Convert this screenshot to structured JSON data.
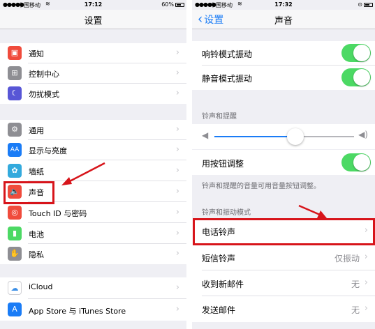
{
  "left": {
    "status": {
      "carrier": "中国移动",
      "time": "17:12",
      "battery": "60%"
    },
    "title": "设置",
    "rows": [
      {
        "label": "通知",
        "icon_color": "#f04b3c"
      },
      {
        "label": "控制中心",
        "icon_color": "#8e8e93"
      },
      {
        "label": "勿扰模式",
        "icon_color": "#5856d6"
      },
      {
        "label": "通用",
        "icon_color": "#8e8e93"
      },
      {
        "label": "显示与亮度",
        "icon_color": "#1a7cf6",
        "icon_text": "AA"
      },
      {
        "label": "墙纸",
        "icon_color": "#33aadd"
      },
      {
        "label": "声音",
        "icon_color": "#f04b3c"
      },
      {
        "label": "Touch ID 与密码",
        "icon_color": "#f04b3c"
      },
      {
        "label": "电池",
        "icon_color": "#4cd964"
      },
      {
        "label": "隐私",
        "icon_color": "#8e8e93"
      },
      {
        "label": "iCloud",
        "icon_color": "#ffffff"
      },
      {
        "label": "App Store 与 iTunes Store",
        "icon_color": "#1a7cf6"
      }
    ]
  },
  "right": {
    "status": {
      "carrier": "中国移动",
      "time": "17:32"
    },
    "back_label": "设置",
    "title": "声音",
    "vibrate_ring": "响铃模式振动",
    "vibrate_silent": "静音模式振动",
    "section_ringer": "铃声和提醒",
    "volume_level": 0.58,
    "adjust_with_buttons": "用按钮调整",
    "note": "铃声和提醒的音量可用音量按钮调整。",
    "section_patterns": "铃声和振动模式",
    "ringtone": "电话铃声",
    "text_tone": "短信铃声",
    "text_tone_value": "仅振动",
    "new_mail": "收到新邮件",
    "new_mail_value": "无",
    "sent_mail": "发送邮件",
    "sent_mail_value": "无"
  },
  "colors": {
    "accent": "#1a7cf6",
    "toggle_on": "#4cd964",
    "highlight": "#d7141a"
  }
}
